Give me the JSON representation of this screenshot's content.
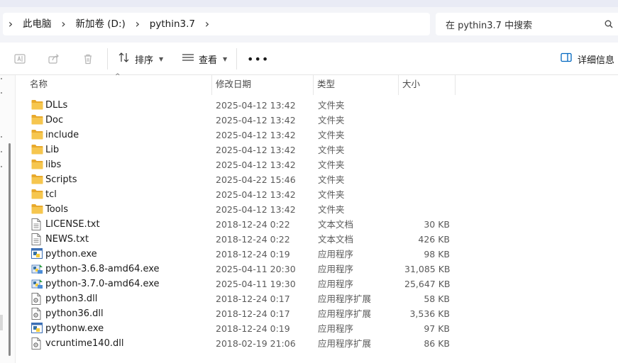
{
  "breadcrumb": [
    "此电脑",
    "新加卷 (D:)",
    "pythin3.7"
  ],
  "search": {
    "placeholder": "在 pythin3.7 中搜索"
  },
  "toolbar": {
    "sort_label": "排序",
    "view_label": "查看",
    "more_label": "•••",
    "details_label": "详细信息"
  },
  "columns": {
    "name": "名称",
    "date": "修改日期",
    "type": "类型",
    "size": "大小"
  },
  "colors": {
    "folder": "#f3c24a",
    "accent": "#0067c0"
  },
  "files": [
    {
      "name": "DLLs",
      "date": "2025-04-12 13:42",
      "type": "文件夹",
      "size": "",
      "icon": "folder"
    },
    {
      "name": "Doc",
      "date": "2025-04-12 13:42",
      "type": "文件夹",
      "size": "",
      "icon": "folder"
    },
    {
      "name": "include",
      "date": "2025-04-12 13:42",
      "type": "文件夹",
      "size": "",
      "icon": "folder"
    },
    {
      "name": "Lib",
      "date": "2025-04-12 13:42",
      "type": "文件夹",
      "size": "",
      "icon": "folder"
    },
    {
      "name": "libs",
      "date": "2025-04-12 13:42",
      "type": "文件夹",
      "size": "",
      "icon": "folder"
    },
    {
      "name": "Scripts",
      "date": "2025-04-22 15:46",
      "type": "文件夹",
      "size": "",
      "icon": "folder"
    },
    {
      "name": "tcl",
      "date": "2025-04-12 13:42",
      "type": "文件夹",
      "size": "",
      "icon": "folder"
    },
    {
      "name": "Tools",
      "date": "2025-04-12 13:42",
      "type": "文件夹",
      "size": "",
      "icon": "folder"
    },
    {
      "name": "LICENSE.txt",
      "date": "2018-12-24 0:22",
      "type": "文本文档",
      "size": "30 KB",
      "icon": "text"
    },
    {
      "name": "NEWS.txt",
      "date": "2018-12-24 0:22",
      "type": "文本文档",
      "size": "426 KB",
      "icon": "text"
    },
    {
      "name": "python.exe",
      "date": "2018-12-24 0:19",
      "type": "应用程序",
      "size": "98 KB",
      "icon": "python-exe"
    },
    {
      "name": "python-3.6.8-amd64.exe",
      "date": "2025-04-11 20:30",
      "type": "应用程序",
      "size": "31,085 KB",
      "icon": "installer"
    },
    {
      "name": "python-3.7.0-amd64.exe",
      "date": "2025-04-11 19:30",
      "type": "应用程序",
      "size": "25,647 KB",
      "icon": "installer"
    },
    {
      "name": "python3.dll",
      "date": "2018-12-24 0:17",
      "type": "应用程序扩展",
      "size": "58 KB",
      "icon": "dll"
    },
    {
      "name": "python36.dll",
      "date": "2018-12-24 0:17",
      "type": "应用程序扩展",
      "size": "3,536 KB",
      "icon": "dll"
    },
    {
      "name": "pythonw.exe",
      "date": "2018-12-24 0:19",
      "type": "应用程序",
      "size": "97 KB",
      "icon": "python-exe"
    },
    {
      "name": "vcruntime140.dll",
      "date": "2018-02-19 21:06",
      "type": "应用程序扩展",
      "size": "86 KB",
      "icon": "dll"
    }
  ]
}
